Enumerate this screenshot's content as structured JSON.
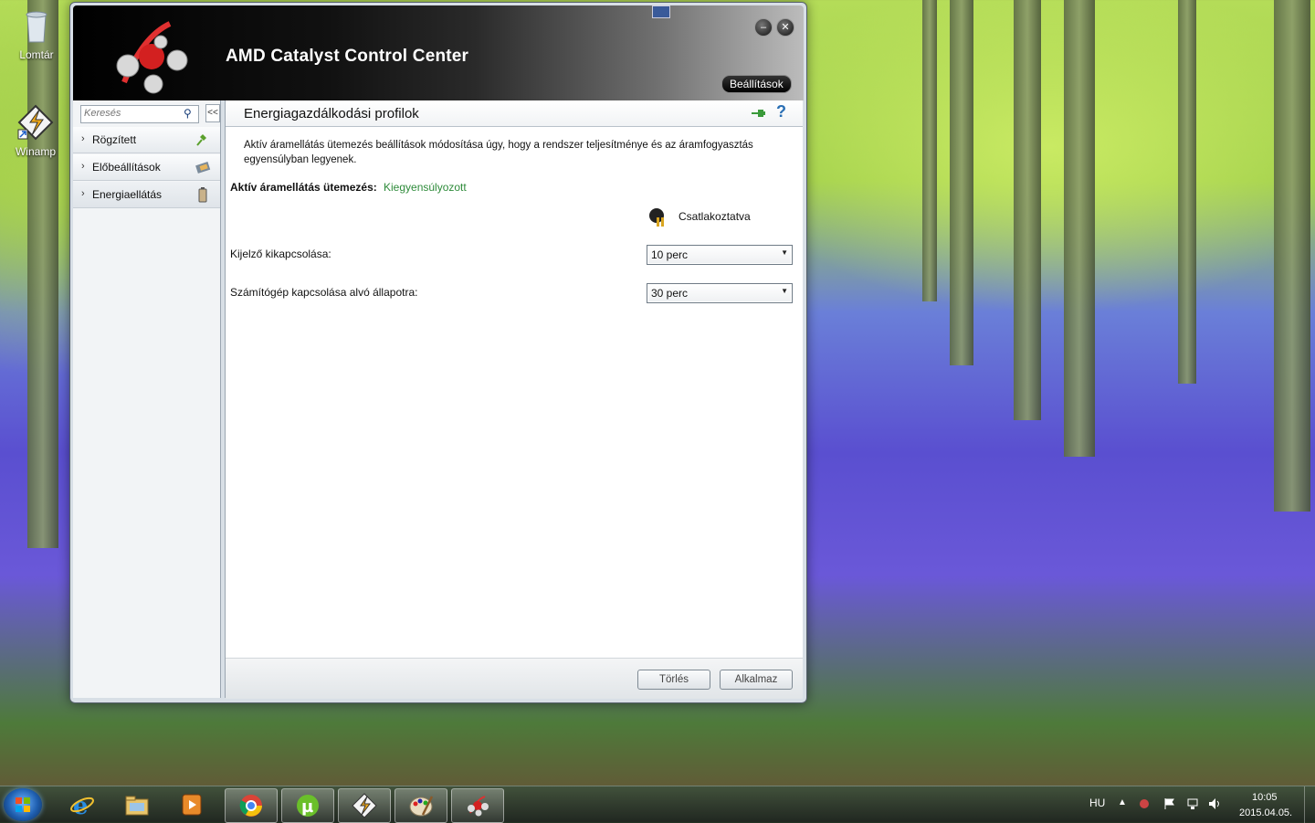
{
  "desktop": {
    "icons": [
      {
        "label": "Lomtár",
        "icon": "recycle-bin-icon"
      },
      {
        "label": "Winamp",
        "icon": "winamp-icon"
      }
    ]
  },
  "window": {
    "title": "AMD Catalyst Control Center",
    "settings_label": "Beállítások",
    "minimize_glyph": "–",
    "close_glyph": "✕"
  },
  "sidebar": {
    "search_placeholder": "Keresés",
    "collapse_glyph": "<<",
    "items": [
      {
        "label": "Rögzített",
        "icon": "pin-icon"
      },
      {
        "label": "Előbeállítások",
        "icon": "presets-icon"
      },
      {
        "label": "Energiaellátás",
        "icon": "battery-icon"
      }
    ]
  },
  "main": {
    "title": "Energiagazdálkodási profilok",
    "description": "Aktív áramellátás ütemezés beállítások módosítása úgy, hogy a rendszer teljesítménye és az áramfogyasztás egyensúlyban legyenek.",
    "schedule_label": "Aktív áramellátás ütemezés:",
    "schedule_value": "Kiegyensúlyozott",
    "power_source_label": "Csatlakoztatva",
    "rows": [
      {
        "label": "Kijelző kikapcsolása:",
        "value": "10 perc"
      },
      {
        "label": "Számítógép kapcsolása alvó állapotra:",
        "value": "30 perc"
      }
    ],
    "buttons": {
      "discard": "Törlés",
      "apply": "Alkalmaz"
    },
    "help_glyph": "?"
  },
  "taskbar": {
    "pinned": [
      "internet-explorer-icon",
      "file-explorer-icon",
      "media-player-icon",
      "chrome-icon",
      "utorrent-icon",
      "winamp-icon",
      "paint-icon",
      "amd-catalyst-icon"
    ],
    "language": "HU",
    "time": "10:05",
    "date": "2015.04.05."
  }
}
